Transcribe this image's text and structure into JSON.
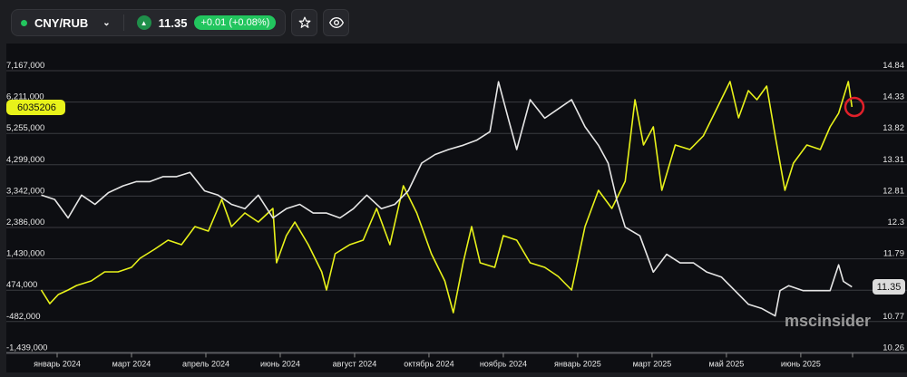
{
  "header": {
    "pair": "CNY/RUB",
    "price": "11.35",
    "change": "+0.01 (+0.08%)",
    "status_color": "#22c55e"
  },
  "icons": [
    "chevron-down-icon",
    "triangle-up-icon",
    "star-icon",
    "eye-icon"
  ],
  "watermark": "mscinsider",
  "chart_data": {
    "type": "line",
    "x_unit": "days since 2024-01-01",
    "x_ticks": [
      {
        "label": "январь 2024",
        "day": 0
      },
      {
        "label": "март 2024",
        "day": 61
      },
      {
        "label": "апрель 2024",
        "day": 122
      },
      {
        "label": "июнь 2024",
        "day": 183
      },
      {
        "label": "август 2024",
        "day": 244
      },
      {
        "label": "октябрь 2024",
        "day": 305
      },
      {
        "label": "ноябрь 2024",
        "day": 366
      },
      {
        "label": "январь 2025",
        "day": 427
      },
      {
        "label": "март 2025",
        "day": 488
      },
      {
        "label": "май 2025",
        "day": 549
      },
      {
        "label": "июнь 2025",
        "day": 610
      }
    ],
    "left_axis": {
      "ticks": [
        "7,167,000",
        "6,211,000",
        "5,255,000",
        "4,299,000",
        "3,342,000",
        "2,386,000",
        "1,430,000",
        "474,000",
        "-482,000",
        "-1,439,000"
      ],
      "range": [
        -1439000,
        7167000
      ]
    },
    "right_axis": {
      "ticks": [
        "14.84",
        "14.33",
        "13.82",
        "13.31",
        "12.81",
        "12.3",
        "11.79",
        "11.28",
        "10.77",
        "10.26"
      ],
      "range": [
        10.26,
        14.84
      ]
    },
    "last_left_label": "6035206",
    "last_right_label": "11.35",
    "series": [
      {
        "name": "volume",
        "axis": "left",
        "color": "#e8f21a",
        "unit": "thousands",
        "points": [
          [
            -13,
            478
          ],
          [
            -6,
            63
          ],
          [
            1,
            340
          ],
          [
            9,
            478
          ],
          [
            16,
            616
          ],
          [
            28,
            754
          ],
          [
            39,
            1031
          ],
          [
            50,
            1031
          ],
          [
            61,
            1169
          ],
          [
            68,
            1445
          ],
          [
            80,
            1722
          ],
          [
            91,
            1998
          ],
          [
            102,
            1860
          ],
          [
            113,
            2413
          ],
          [
            124,
            2275
          ],
          [
            135,
            3242
          ],
          [
            143,
            2413
          ],
          [
            154,
            2827
          ],
          [
            165,
            2551
          ],
          [
            177,
            2966
          ],
          [
            180,
            1307
          ],
          [
            188,
            2136
          ],
          [
            195,
            2551
          ],
          [
            206,
            1860
          ],
          [
            217,
            1031
          ],
          [
            221,
            478
          ],
          [
            228,
            1584
          ],
          [
            240,
            1860
          ],
          [
            251,
            1998
          ],
          [
            262,
            2966
          ],
          [
            273,
            1860
          ],
          [
            284,
            3657
          ],
          [
            295,
            2827
          ],
          [
            307,
            1584
          ],
          [
            318,
            754
          ],
          [
            325,
            -213
          ],
          [
            333,
            1307
          ],
          [
            340,
            2413
          ],
          [
            347,
            1307
          ],
          [
            359,
            1169
          ],
          [
            366,
            2136
          ],
          [
            377,
            1998
          ],
          [
            388,
            1307
          ],
          [
            400,
            1169
          ],
          [
            411,
            893
          ],
          [
            422,
            478
          ],
          [
            433,
            2413
          ],
          [
            444,
            3518
          ],
          [
            455,
            2966
          ],
          [
            466,
            3795
          ],
          [
            474,
            6282
          ],
          [
            481,
            4901
          ],
          [
            489,
            5453
          ],
          [
            496,
            3518
          ],
          [
            507,
            4901
          ],
          [
            519,
            4762
          ],
          [
            530,
            5177
          ],
          [
            541,
            6006
          ],
          [
            552,
            6835
          ],
          [
            559,
            5730
          ],
          [
            567,
            6559
          ],
          [
            574,
            6282
          ],
          [
            582,
            6697
          ],
          [
            589,
            5177
          ],
          [
            597,
            3518
          ],
          [
            604,
            4348
          ],
          [
            615,
            4901
          ],
          [
            626,
            4762
          ],
          [
            634,
            5453
          ],
          [
            641,
            5868
          ],
          [
            649,
            6835
          ],
          [
            652,
            6061
          ]
        ]
      },
      {
        "name": "price",
        "axis": "right",
        "color": "#e6e6e6",
        "points": [
          [
            -13,
            12.82
          ],
          [
            -2,
            12.75
          ],
          [
            9,
            12.45
          ],
          [
            20,
            12.82
          ],
          [
            31,
            12.67
          ],
          [
            42,
            12.86
          ],
          [
            54,
            12.97
          ],
          [
            65,
            13.04
          ],
          [
            76,
            13.04
          ],
          [
            87,
            13.12
          ],
          [
            98,
            13.12
          ],
          [
            109,
            13.19
          ],
          [
            121,
            12.89
          ],
          [
            132,
            12.82
          ],
          [
            143,
            12.67
          ],
          [
            154,
            12.6
          ],
          [
            165,
            12.82
          ],
          [
            177,
            12.45
          ],
          [
            188,
            12.6
          ],
          [
            199,
            12.67
          ],
          [
            210,
            12.53
          ],
          [
            221,
            12.53
          ],
          [
            232,
            12.45
          ],
          [
            243,
            12.6
          ],
          [
            254,
            12.82
          ],
          [
            266,
            12.6
          ],
          [
            277,
            12.67
          ],
          [
            288,
            12.89
          ],
          [
            299,
            13.34
          ],
          [
            310,
            13.48
          ],
          [
            321,
            13.56
          ],
          [
            333,
            13.63
          ],
          [
            344,
            13.71
          ],
          [
            355,
            13.85
          ],
          [
            362,
            14.66
          ],
          [
            370,
            14.07
          ],
          [
            377,
            13.56
          ],
          [
            388,
            14.37
          ],
          [
            400,
            14.07
          ],
          [
            411,
            14.22
          ],
          [
            422,
            14.37
          ],
          [
            433,
            13.93
          ],
          [
            444,
            13.63
          ],
          [
            452,
            13.34
          ],
          [
            459,
            12.75
          ],
          [
            466,
            12.3
          ],
          [
            478,
            12.16
          ],
          [
            489,
            11.57
          ],
          [
            500,
            11.86
          ],
          [
            511,
            11.72
          ],
          [
            522,
            11.72
          ],
          [
            533,
            11.57
          ],
          [
            545,
            11.49
          ],
          [
            556,
            11.27
          ],
          [
            567,
            11.05
          ],
          [
            578,
            10.98
          ],
          [
            589,
            10.86
          ],
          [
            593,
            11.27
          ],
          [
            600,
            11.35
          ],
          [
            612,
            11.27
          ],
          [
            623,
            11.27
          ],
          [
            634,
            11.27
          ],
          [
            641,
            11.69
          ],
          [
            645,
            11.42
          ],
          [
            652,
            11.33
          ]
        ]
      }
    ]
  }
}
